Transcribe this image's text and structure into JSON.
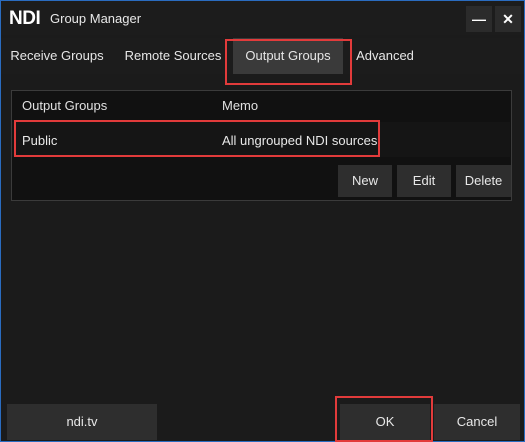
{
  "window": {
    "logo": "NDI",
    "title": "Group Manager",
    "minimize": "—",
    "close": "✕"
  },
  "tabs": [
    {
      "label": "Receive Groups"
    },
    {
      "label": "Remote Sources"
    },
    {
      "label": "Output Groups"
    },
    {
      "label": "Advanced"
    }
  ],
  "table": {
    "columns": [
      "Output Groups",
      "Memo"
    ],
    "rows": [
      {
        "name": "Public",
        "memo": "All ungrouped NDI sources"
      }
    ]
  },
  "actions": {
    "new": "New",
    "edit": "Edit",
    "delete": "Delete"
  },
  "footer": {
    "link": "ndi.tv",
    "ok": "OK",
    "cancel": "Cancel"
  },
  "colors": {
    "highlight": "#e23b3b",
    "accent_border": "#2a6cc0",
    "background": "#1b1b1b"
  },
  "icons": {
    "minimize": "minimize-icon",
    "close": "close-icon"
  }
}
